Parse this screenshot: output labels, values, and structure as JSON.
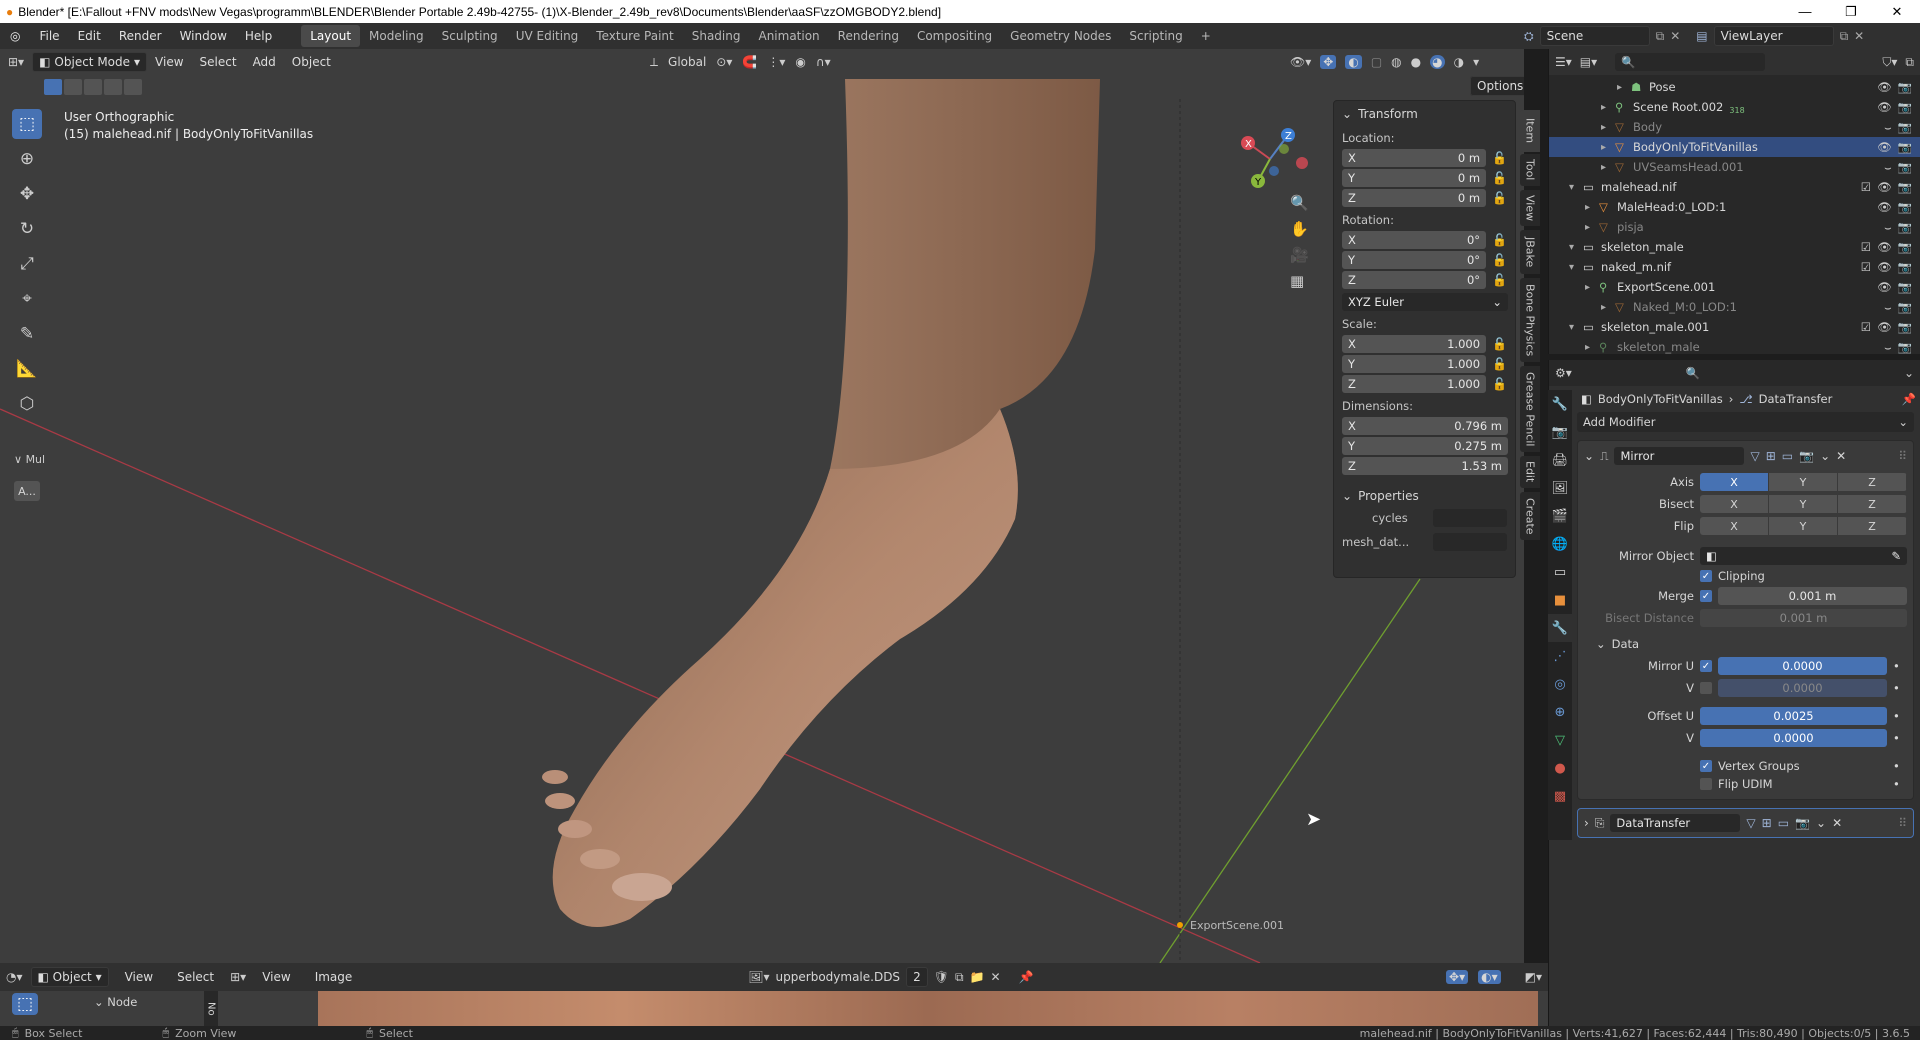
{
  "title": "Blender* [E:\\Fallout +FNV mods\\New Vegas\\programm\\BLENDER\\Blender Portable 2.49b-42755- (1)\\X-Blender_2.49b_rev8\\Documents\\Blender\\aaSF\\zzOMGBODY2.blend]",
  "menu": [
    "File",
    "Edit",
    "Render",
    "Window",
    "Help"
  ],
  "workspaces": [
    "Layout",
    "Modeling",
    "Sculpting",
    "UV Editing",
    "Texture Paint",
    "Shading",
    "Animation",
    "Rendering",
    "Compositing",
    "Geometry Nodes",
    "Scripting"
  ],
  "active_workspace": "Layout",
  "scene": "Scene",
  "view_layer": "ViewLayer",
  "viewport_header": {
    "mode": "Object Mode",
    "menus": [
      "View",
      "Select",
      "Add",
      "Object"
    ],
    "orientation": "Global",
    "options": "Options"
  },
  "viewport": {
    "view_name": "User Orthographic",
    "object_info": "(15) malehead.nif | BodyOnlyToFitVanillas",
    "origin_label": "ExportScene.001",
    "tool_settings_label": "Mul",
    "tool_settings_btn": "A...",
    "gizmo": {
      "x": "X",
      "y": "Y",
      "z": "Z"
    }
  },
  "npanel": {
    "transform_title": "Transform",
    "location_label": "Location:",
    "location": [
      {
        "axis": "X",
        "value": "0 m"
      },
      {
        "axis": "Y",
        "value": "0 m"
      },
      {
        "axis": "Z",
        "value": "0 m"
      }
    ],
    "rotation_label": "Rotation:",
    "rotation": [
      {
        "axis": "X",
        "value": "0°"
      },
      {
        "axis": "Y",
        "value": "0°"
      },
      {
        "axis": "Z",
        "value": "0°"
      }
    ],
    "rotation_mode": "XYZ Euler",
    "scale_label": "Scale:",
    "scale": [
      {
        "axis": "X",
        "value": "1.000"
      },
      {
        "axis": "Y",
        "value": "1.000"
      },
      {
        "axis": "Z",
        "value": "1.000"
      }
    ],
    "dimensions_label": "Dimensions:",
    "dimensions": [
      {
        "axis": "X",
        "value": "0.796 m"
      },
      {
        "axis": "Y",
        "value": "0.275 m"
      },
      {
        "axis": "Z",
        "value": "1.53 m"
      }
    ],
    "properties_title": "Properties",
    "prop1": "cycles",
    "prop2": "mesh_dat...",
    "tabs": [
      "Item",
      "Tool",
      "View",
      "JBake",
      "Bone Physics",
      "Grease Pencil",
      "Edit",
      "Create"
    ]
  },
  "outliner": {
    "rows": [
      {
        "label": "Pose",
        "indent": 3,
        "icon": "pose-icon",
        "dim": false
      },
      {
        "label": "Scene Root.002",
        "indent": 2,
        "icon": "armature-icon",
        "dim": false,
        "badge": "318"
      },
      {
        "label": "Body",
        "indent": 2,
        "icon": "mesh-icon",
        "dim": true
      },
      {
        "label": "BodyOnlyToFitVanillas",
        "indent": 2,
        "icon": "mesh-icon",
        "dim": false,
        "selected": true
      },
      {
        "label": "UVSeamsHead.001",
        "indent": 2,
        "icon": "mesh-icon",
        "dim": true
      },
      {
        "label": "malehead.nif",
        "indent": 0,
        "icon": "collection-icon",
        "dim": false
      },
      {
        "label": "MaleHead:0_LOD:1",
        "indent": 1,
        "icon": "mesh-icon",
        "dim": false
      },
      {
        "label": "pisja",
        "indent": 1,
        "icon": "mesh-icon",
        "dim": true
      },
      {
        "label": "skeleton_male",
        "indent": 0,
        "icon": "collection-icon",
        "dim": false
      },
      {
        "label": "naked_m.nif",
        "indent": 0,
        "icon": "collection-icon",
        "dim": false
      },
      {
        "label": "ExportScene.001",
        "indent": 1,
        "icon": "armature-icon",
        "dim": false
      },
      {
        "label": "Naked_M:0_LOD:1",
        "indent": 2,
        "icon": "mesh-icon",
        "dim": true
      },
      {
        "label": "skeleton_male.001",
        "indent": 0,
        "icon": "collection-icon",
        "dim": false
      },
      {
        "label": "skeleton_male",
        "indent": 1,
        "icon": "armature-icon",
        "dim": true
      }
    ]
  },
  "properties": {
    "breadcrumb_object": "BodyOnlyToFitVanillas",
    "breadcrumb_modifier": "DataTransfer",
    "add_modifier": "Add Modifier",
    "mirror": {
      "name": "Mirror",
      "axis_label": "Axis",
      "bisect_label": "Bisect",
      "flip_label": "Flip",
      "xyz": [
        "X",
        "Y",
        "Z"
      ],
      "mirror_object_label": "Mirror Object",
      "clipping": "Clipping",
      "merge_label": "Merge",
      "merge_value": "0.001 m",
      "bisect_distance_label": "Bisect Distance",
      "bisect_distance_value": "0.001 m",
      "data_label": "Data",
      "mirror_u_label": "Mirror U",
      "mirror_u_value": "0.0000",
      "v_label": "V",
      "mirror_v_value": "0.0000",
      "offset_u_label": "Offset U",
      "offset_u_value": "0.0025",
      "offset_v_value": "0.0000",
      "vertex_groups": "Vertex Groups",
      "flip_udim": "Flip UDIM"
    },
    "datatransfer": {
      "name": "DataTransfer"
    }
  },
  "image_editor": {
    "mode": "Object",
    "menus": [
      "View",
      "Select"
    ],
    "menus2": [
      "View",
      "Image"
    ],
    "image_name": "upperbodymale.DDS",
    "users": "2",
    "node_label": "Node",
    "side_tab": "No"
  },
  "status": {
    "left1": "Box Select",
    "left2": "Zoom View",
    "left3": "Select",
    "right": "malehead.nif | BodyOnlyToFitVanillas | Verts:41,627 | Faces:62,444 | Tris:80,490 | Objects:0/5 | 3.6.5"
  },
  "colors": {
    "accent": "#4772b3",
    "viewport_bg": "#3d3d3d",
    "panel": "#303030",
    "skin": "#b88a6e"
  }
}
